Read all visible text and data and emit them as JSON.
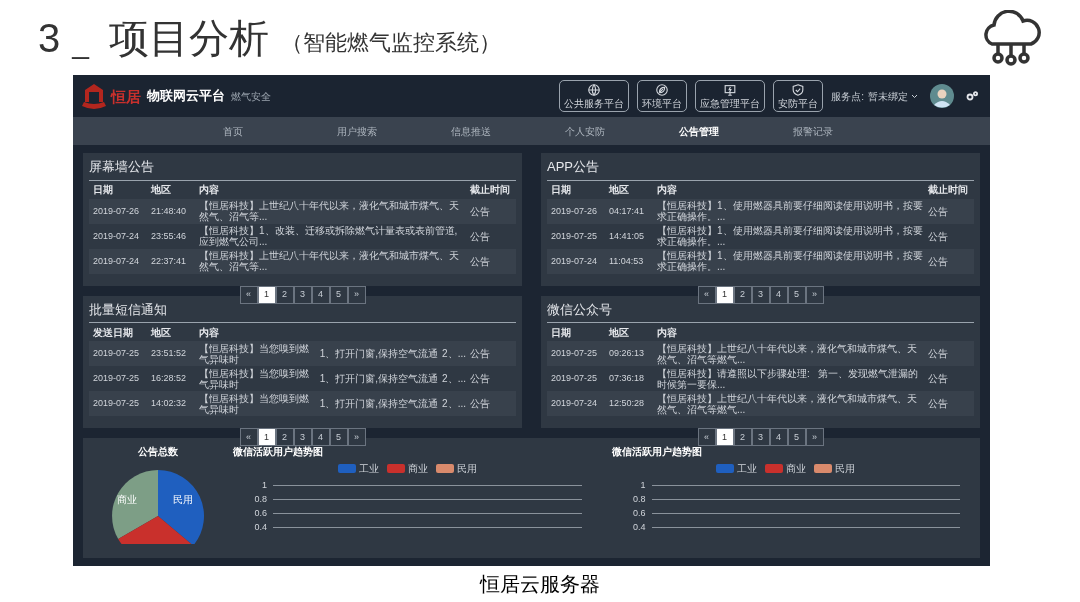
{
  "slide": {
    "number": "3",
    "separator": "_",
    "title": "项目分析",
    "subtitle": "（智能燃气监控系统）",
    "caption": "恒居云服务器"
  },
  "app": {
    "logo_text": "恒居",
    "title": "物联网云平台",
    "subtitle": "燃气安全",
    "platform_buttons": [
      {
        "label": "公共服务平台",
        "kind": "globe"
      },
      {
        "label": "环境平台",
        "kind": "leaf"
      },
      {
        "label": "应急管理平台",
        "kind": "monitor"
      },
      {
        "label": "安防平台",
        "kind": "shield"
      }
    ],
    "service_point": {
      "label": "服务点:",
      "value": "暂未绑定"
    },
    "nav": [
      {
        "label": "首页",
        "selected": false
      },
      {
        "label": "用户搜索",
        "selected": false
      },
      {
        "label": "信息推送",
        "selected": false
      },
      {
        "label": "个人安防",
        "selected": false
      },
      {
        "label": "公告管理",
        "selected": true
      },
      {
        "label": "报警记录",
        "selected": false
      }
    ],
    "panels": [
      {
        "title": "屏幕墙公告",
        "columns": [
          "日期",
          "地区",
          "内容",
          "截止时间"
        ],
        "rows": [
          [
            "2019-07-26",
            "21:48:40",
            "【恒居科技】上世纪八十年代以来，液化气和城市煤气、天然气、沼气等...",
            "公告"
          ],
          [
            "2019-07-24",
            "23:55:46",
            "【恒居科技】1、改装、迁移或拆除燃气计量表或表前管道,应到燃气公司...",
            "公告"
          ],
          [
            "2019-07-24",
            "22:37:41",
            "【恒居科技】上世纪八十年代以来，液化气和城市煤气、天然气、沼气等...",
            "公告"
          ]
        ],
        "pagination": [
          {
            "label": "«",
            "selected": false
          },
          {
            "label": "1",
            "selected": true
          },
          {
            "label": "2",
            "selected": false
          },
          {
            "label": "3",
            "selected": false
          },
          {
            "label": "4",
            "selected": false
          },
          {
            "label": "5",
            "selected": false
          },
          {
            "label": "»",
            "selected": false
          }
        ]
      },
      {
        "title": "APP公告",
        "columns": [
          "日期",
          "地区",
          "内容",
          "截止时间"
        ],
        "rows": [
          [
            "2019-07-26",
            "04:17:41",
            "【恒居科技】1、使用燃器具前要仔细阅读使用说明书，按要求正确操作。...",
            "公告"
          ],
          [
            "2019-07-25",
            "14:41:05",
            "【恒居科技】1、使用燃器具前要仔细阅读使用说明书，按要求正确操作。...",
            "公告"
          ],
          [
            "2019-07-24",
            "11:04:53",
            "【恒居科技】1、使用燃器具前要仔细阅读使用说明书，按要求正确操作。...",
            "公告"
          ]
        ],
        "pagination": [
          {
            "label": "«",
            "selected": false
          },
          {
            "label": "1",
            "selected": true
          },
          {
            "label": "2",
            "selected": false
          },
          {
            "label": "3",
            "selected": false
          },
          {
            "label": "4",
            "selected": false
          },
          {
            "label": "5",
            "selected": false
          },
          {
            "label": "»",
            "selected": false
          }
        ]
      },
      {
        "title": "批量短信通知",
        "columns": [
          "发送日期",
          "地区",
          "内容"
        ],
        "rows": [
          [
            "2019-07-25",
            "23:51:52",
            "【恒居科技】当您嗅到燃气异味时",
            "1、打开门窗,保持空气流通",
            "2、...",
            "公告"
          ],
          [
            "2019-07-25",
            "16:28:52",
            "【恒居科技】当您嗅到燃气异味时",
            "1、打开门窗,保持空气流通",
            "2、...",
            "公告"
          ],
          [
            "2019-07-25",
            "14:02:32",
            "【恒居科技】当您嗅到燃气异味时",
            "1、打开门窗,保持空气流通",
            "2、...",
            "公告"
          ]
        ],
        "pagination": [
          {
            "label": "«",
            "selected": false
          },
          {
            "label": "1",
            "selected": true
          },
          {
            "label": "2",
            "selected": false
          },
          {
            "label": "3",
            "selected": false
          },
          {
            "label": "4",
            "selected": false
          },
          {
            "label": "5",
            "selected": false
          },
          {
            "label": "»",
            "selected": false
          }
        ]
      },
      {
        "title": "微信公众号",
        "columns": [
          "日期",
          "地区",
          "内容"
        ],
        "rows": [
          [
            "2019-07-25",
            "09:26:13",
            "【恒居科技】上世纪八十年代以来，液化气和城市煤气、天然气、沼气等燃气...",
            "公告"
          ],
          [
            "2019-07-25",
            "07:36:18",
            "【恒居科技】请遵照以下步骤处理:   第一、发现燃气泄漏的时候第一要保...",
            "公告"
          ],
          [
            "2019-07-24",
            "12:50:28",
            "【恒居科技】上世纪八十年代以来，液化气和城市煤气、天然气、沼气等燃气...",
            "公告"
          ]
        ],
        "pagination": [
          {
            "label": "«",
            "selected": false
          },
          {
            "label": "1",
            "selected": true
          },
          {
            "label": "2",
            "selected": false
          },
          {
            "label": "3",
            "selected": false
          },
          {
            "label": "4",
            "selected": false
          },
          {
            "label": "5",
            "selected": false
          },
          {
            "label": "»",
            "selected": false
          }
        ]
      }
    ],
    "pie": {
      "title": "公告总数",
      "slices": [
        {
          "label": "商业",
          "color": "#7d9e86"
        },
        {
          "label": "民用",
          "color": "#1f5fbf"
        },
        {
          "color": "#c9302c"
        }
      ]
    },
    "trend_charts": [
      {
        "title": "微信活跃用户趋势图",
        "legend": [
          {
            "label": "工业",
            "color": "#1f5fbf"
          },
          {
            "label": "商业",
            "color": "#c9302c"
          },
          {
            "label": "民用",
            "color": "#d98a6c"
          }
        ],
        "yticks": [
          "1",
          "0.8",
          "0.6",
          "0.4"
        ]
      },
      {
        "title": "微信活跃用户趋势图",
        "legend": [
          {
            "label": "工业",
            "color": "#1f5fbf"
          },
          {
            "label": "商业",
            "color": "#c9302c"
          },
          {
            "label": "民用",
            "color": "#d98a6c"
          }
        ],
        "yticks": [
          "1",
          "0.8",
          "0.6",
          "0.4"
        ]
      }
    ]
  }
}
